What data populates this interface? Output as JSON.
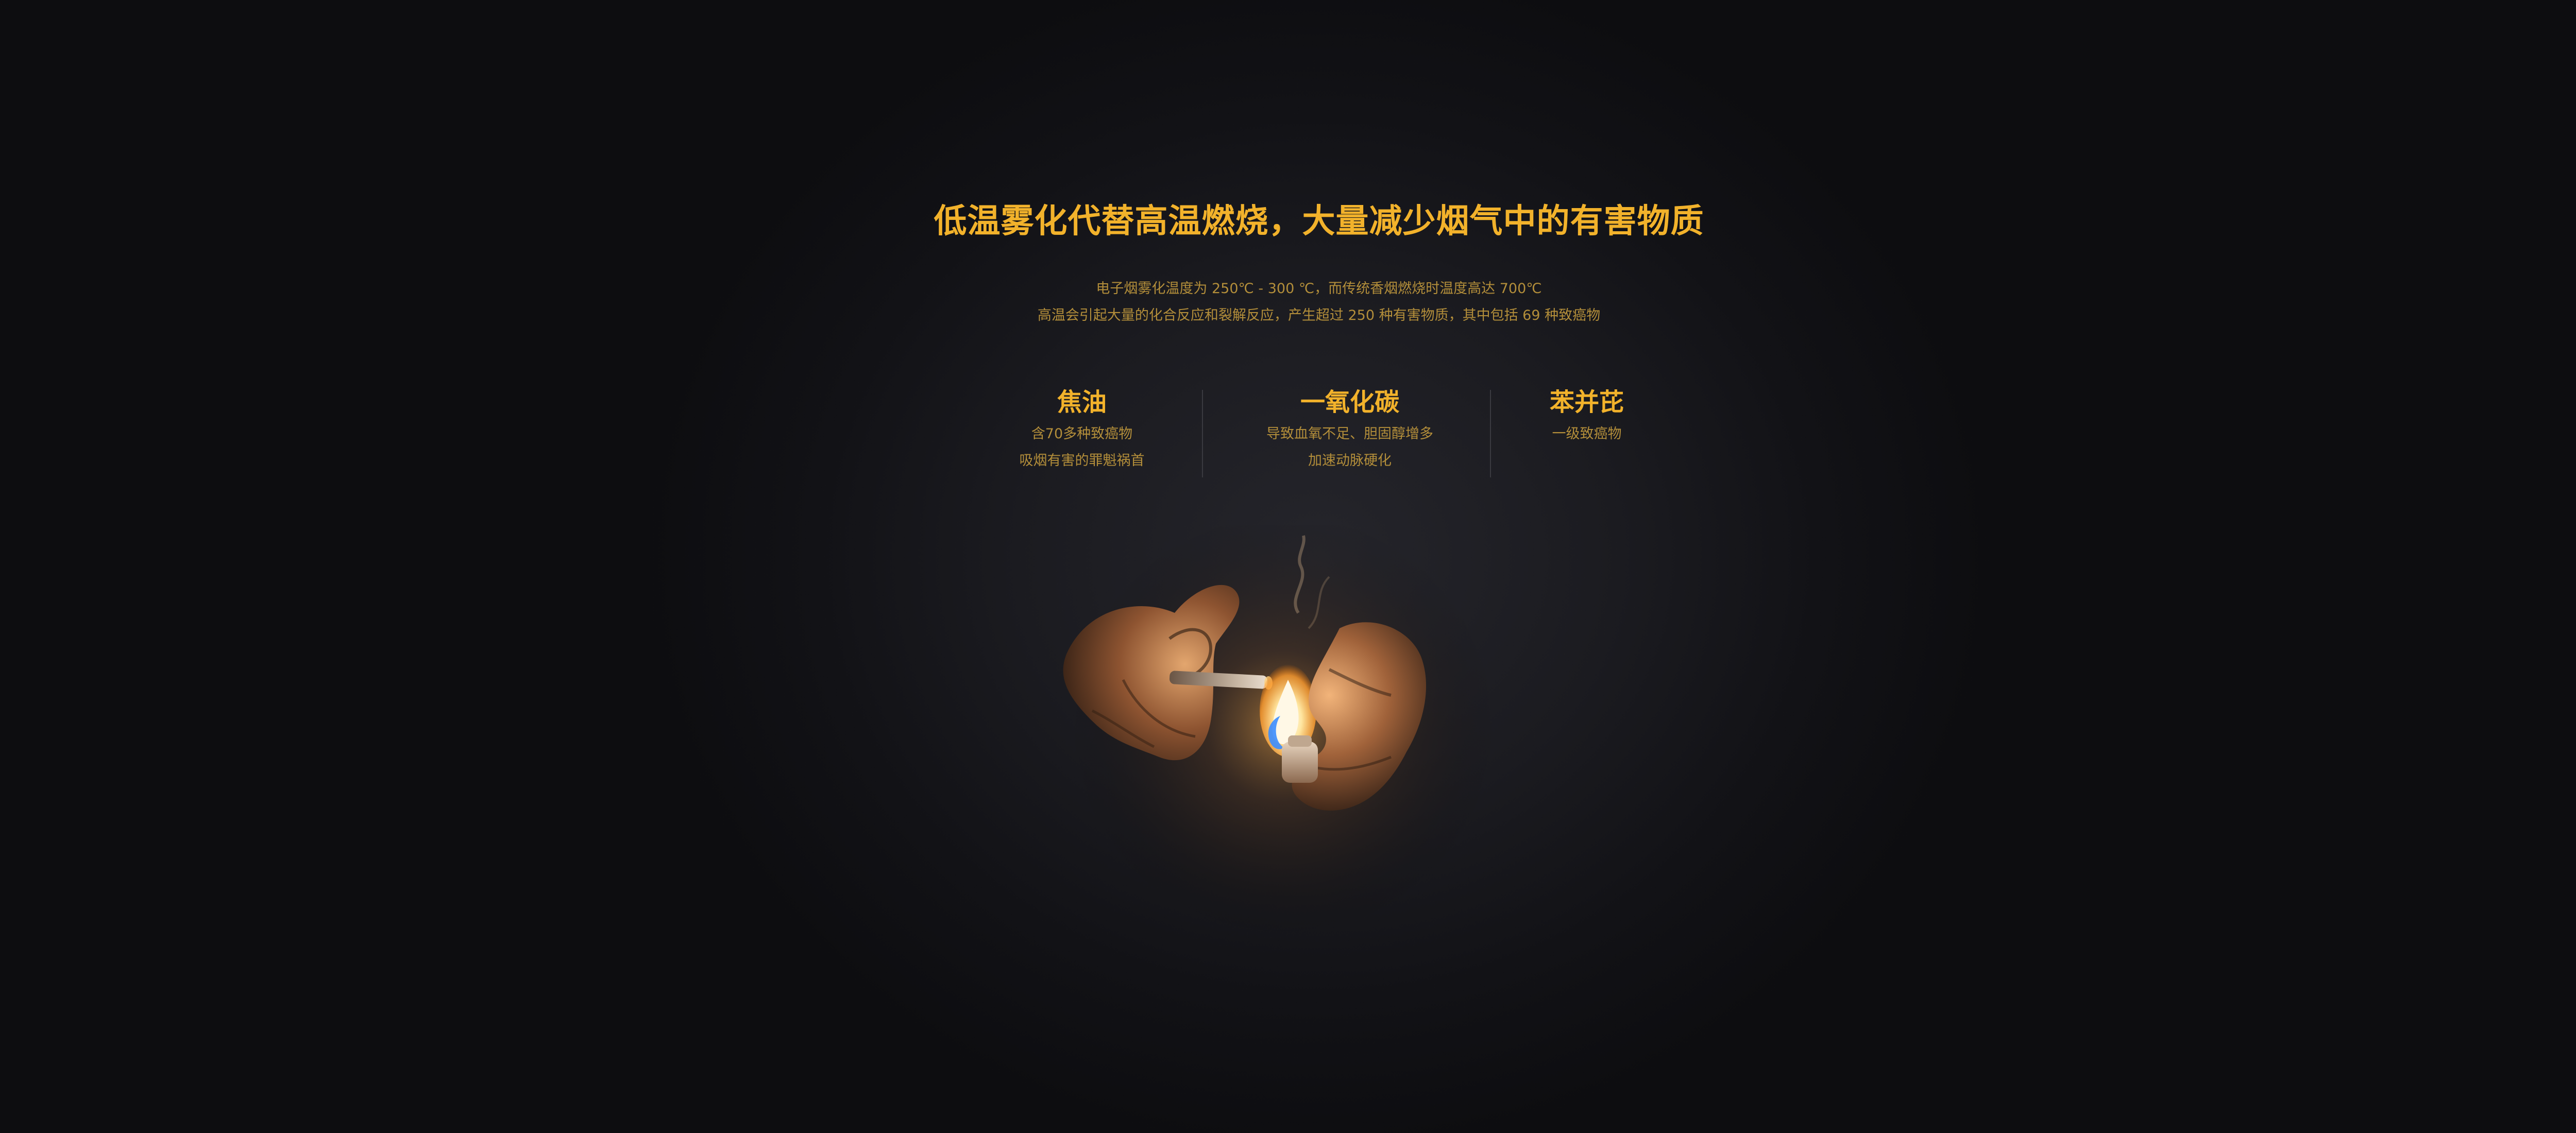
{
  "headline": "低温雾化代替高温燃烧，大量减少烟气中的有害物质",
  "subtitle": {
    "line1": "电子烟雾化温度为 250℃ - 300 ℃，而传统香烟燃烧时温度高达 700℃",
    "line2": "高温会引起大量的化合反应和裂解反应，产生超过 250 种有害物质，其中包括 69 种致癌物"
  },
  "features": [
    {
      "title": "焦油",
      "lines": [
        "含70多种致癌物",
        "吸烟有害的罪魁祸首"
      ]
    },
    {
      "title": "一氧化碳",
      "lines": [
        "导致血氧不足、胆固醇增多",
        "加速动脉硬化"
      ]
    },
    {
      "title": "苯并芘",
      "lines": [
        "一级致癌物"
      ]
    }
  ],
  "colors": {
    "accent": "#f2b22b",
    "body_text": "#b38e3a",
    "background": "#1b1b20"
  },
  "image": {
    "subject": "hands-lighting-cigarette-illustration"
  }
}
